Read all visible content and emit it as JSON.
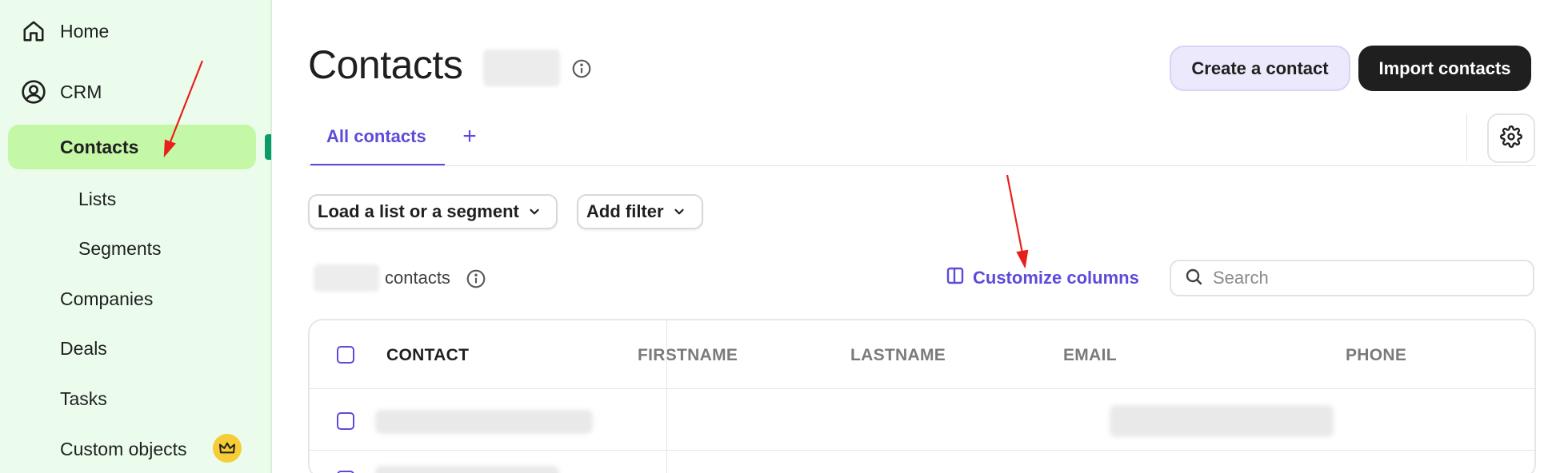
{
  "sidebar": {
    "home_label": "Home",
    "crm_label": "CRM",
    "contacts_label": "Contacts",
    "lists_label": "Lists",
    "segments_label": "Segments",
    "companies_label": "Companies",
    "deals_label": "Deals",
    "tasks_label": "Tasks",
    "custom_objects_label": "Custom objects",
    "custom_objects_badge_icon": "crown-icon"
  },
  "header": {
    "title": "Contacts",
    "create_button": "Create a contact",
    "import_button": "Import contacts"
  },
  "tabs": {
    "active_tab": "All contacts",
    "add_tab": "+"
  },
  "filters": {
    "list_segment": "Load a list or a segment",
    "add_filter": "Add filter"
  },
  "toolbar": {
    "contacts_suffix": "contacts",
    "customize_columns": "Customize columns",
    "search_placeholder": "Search"
  },
  "table": {
    "columns": [
      "CONTACT",
      "FIRSTNAME",
      "LASTNAME",
      "EMAIL",
      "PHONE"
    ]
  },
  "colors": {
    "accent": "#5b4bd8",
    "sidebar_bg": "#ebfcec",
    "active_nav_bg": "#c4f7a6",
    "annotation_arrow": "#e8201c"
  }
}
